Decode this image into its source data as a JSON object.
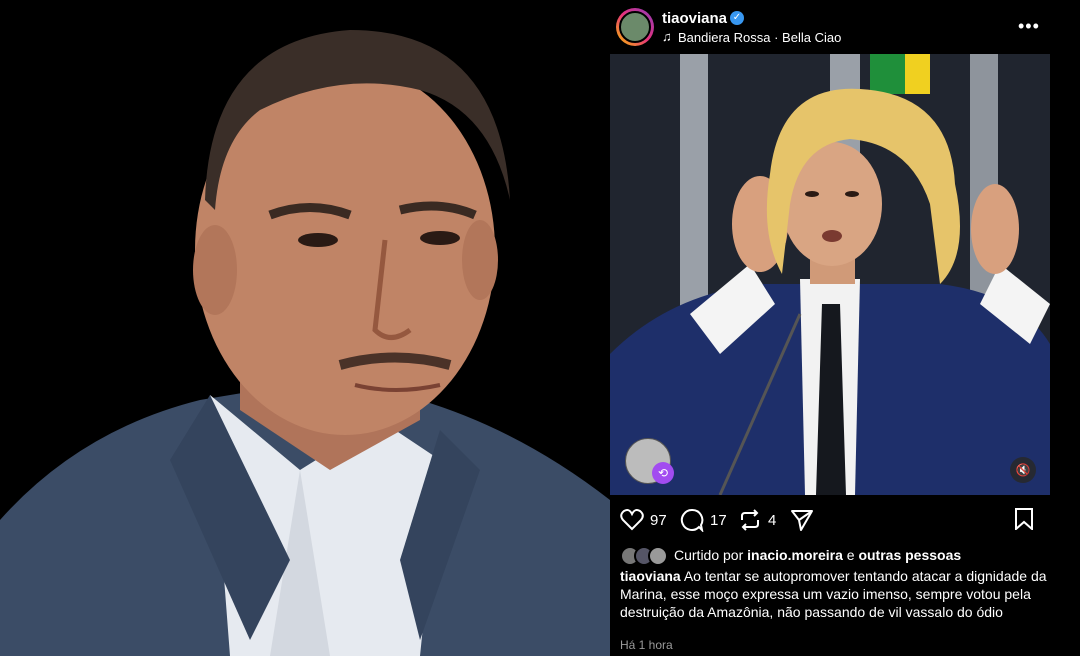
{
  "post": {
    "username": "tiaoviana",
    "music": "Bandiera Rossa · Bella Ciao",
    "likes": "97",
    "comments": "17",
    "reposts": "4",
    "liked_prefix": "Curtido por",
    "liked_user": "inacio.moreira",
    "liked_connector": "e",
    "liked_others": "outras pessoas",
    "caption_user": "tiaoviana",
    "caption_text": "Ao tentar se autopromover tentando atacar a dignidade da Marina, esse moço expressa um vazio imenso, sempre votou pela destruição da Amazônia, não passando de vil vassalo do ódio",
    "time": "Há 1 hora"
  },
  "colors": {
    "verified": "#3897f0",
    "collab_badge": "#a24cf0",
    "timestamp": "#9a9a9a"
  },
  "icons": [
    "verified-icon",
    "music-icon",
    "more-icon",
    "heart-icon",
    "comment-icon",
    "repost-icon",
    "share-icon",
    "save-icon",
    "mute-icon",
    "collab-icon"
  ]
}
